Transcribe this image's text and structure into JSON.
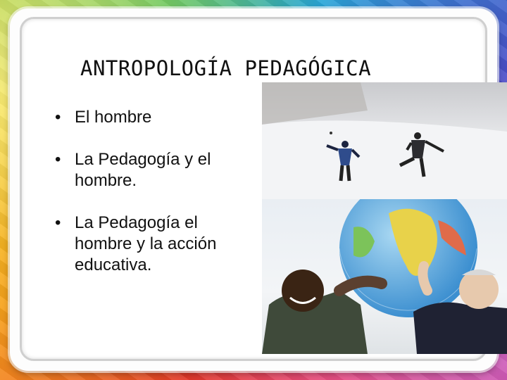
{
  "slide": {
    "title": "ANTROPOLOGÍA PEDAGÓGICA",
    "bullet_symbol": "•",
    "bullets": [
      "El hombre",
      "La Pedagogía y el hombre.",
      "La Pedagogía el hombre y la acción educativa."
    ]
  },
  "images": {
    "top": "people-playing-in-snow-photo",
    "bottom": "two-men-holding-globe-photo"
  },
  "colors": {
    "title": "#111111",
    "slide_background": "#ffffff",
    "border": "#cfcfcf"
  }
}
